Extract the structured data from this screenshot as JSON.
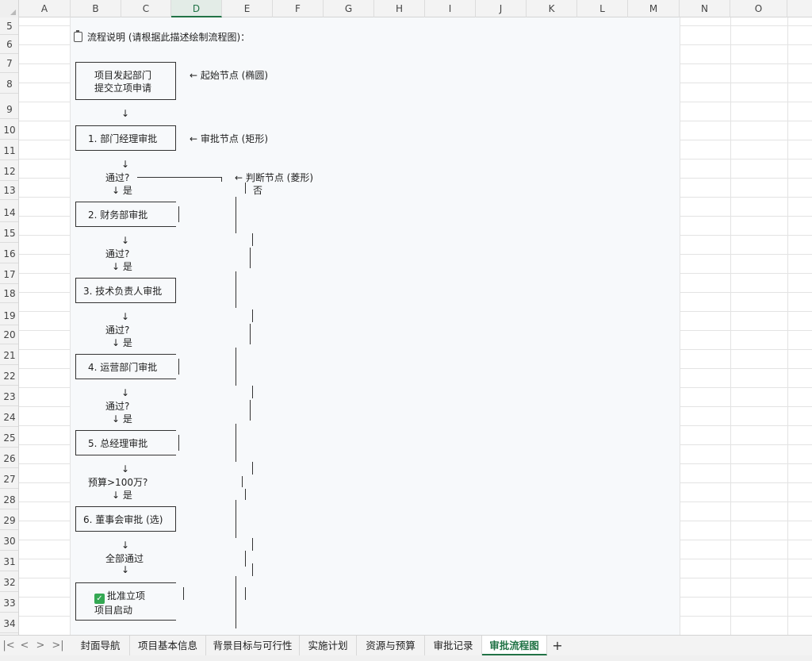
{
  "columns": [
    "A",
    "B",
    "C",
    "D",
    "E",
    "F",
    "G",
    "H",
    "I",
    "J",
    "K",
    "L",
    "M",
    "N",
    "O"
  ],
  "active_column": "D",
  "rows": [
    "5",
    "6",
    "7",
    "8",
    "9",
    "10",
    "11",
    "12",
    "13",
    "14",
    "15",
    "16",
    "17",
    "18",
    "19",
    "20",
    "21",
    "22",
    "23",
    "24",
    "25",
    "26",
    "27",
    "28",
    "29",
    "30",
    "31",
    "32",
    "33",
    "34"
  ],
  "flow": {
    "title": "流程说明 (请根据此描述绘制流程图)：",
    "title_icon": "clipboard-icon",
    "start_line1": "项目发起部门",
    "start_line2": "提交立项申请",
    "note_start": "← 起始节点 (椭圆)",
    "arrow": "↓",
    "step1": "1. 部门经理审批",
    "note_approval": "← 审批节点 (矩形)",
    "pass_q": "通过?",
    "yes": "↓ 是",
    "note_decision": "← 判断节点 (菱形)",
    "no": "否",
    "step2": "2. 财务部审批",
    "step3": "3. 技术负责人审批",
    "step4": "4. 运营部门审批",
    "step5": "5. 总经理审批",
    "budget_q": "预算>100万?",
    "step6": "6. 董事会审批 (选)",
    "all_pass": "全部通过",
    "end_line1": "批准立项",
    "end_line2": "项目启动",
    "end_icon": "check-icon"
  },
  "tabs": [
    "封面导航",
    "项目基本信息",
    "背景目标与可行性",
    "实施计划",
    "资源与预算",
    "审批记录",
    "审批流程图"
  ],
  "active_tab": "审批流程图",
  "add_tab_label": "+",
  "nav": [
    "|<",
    "<",
    ">",
    ">|"
  ]
}
